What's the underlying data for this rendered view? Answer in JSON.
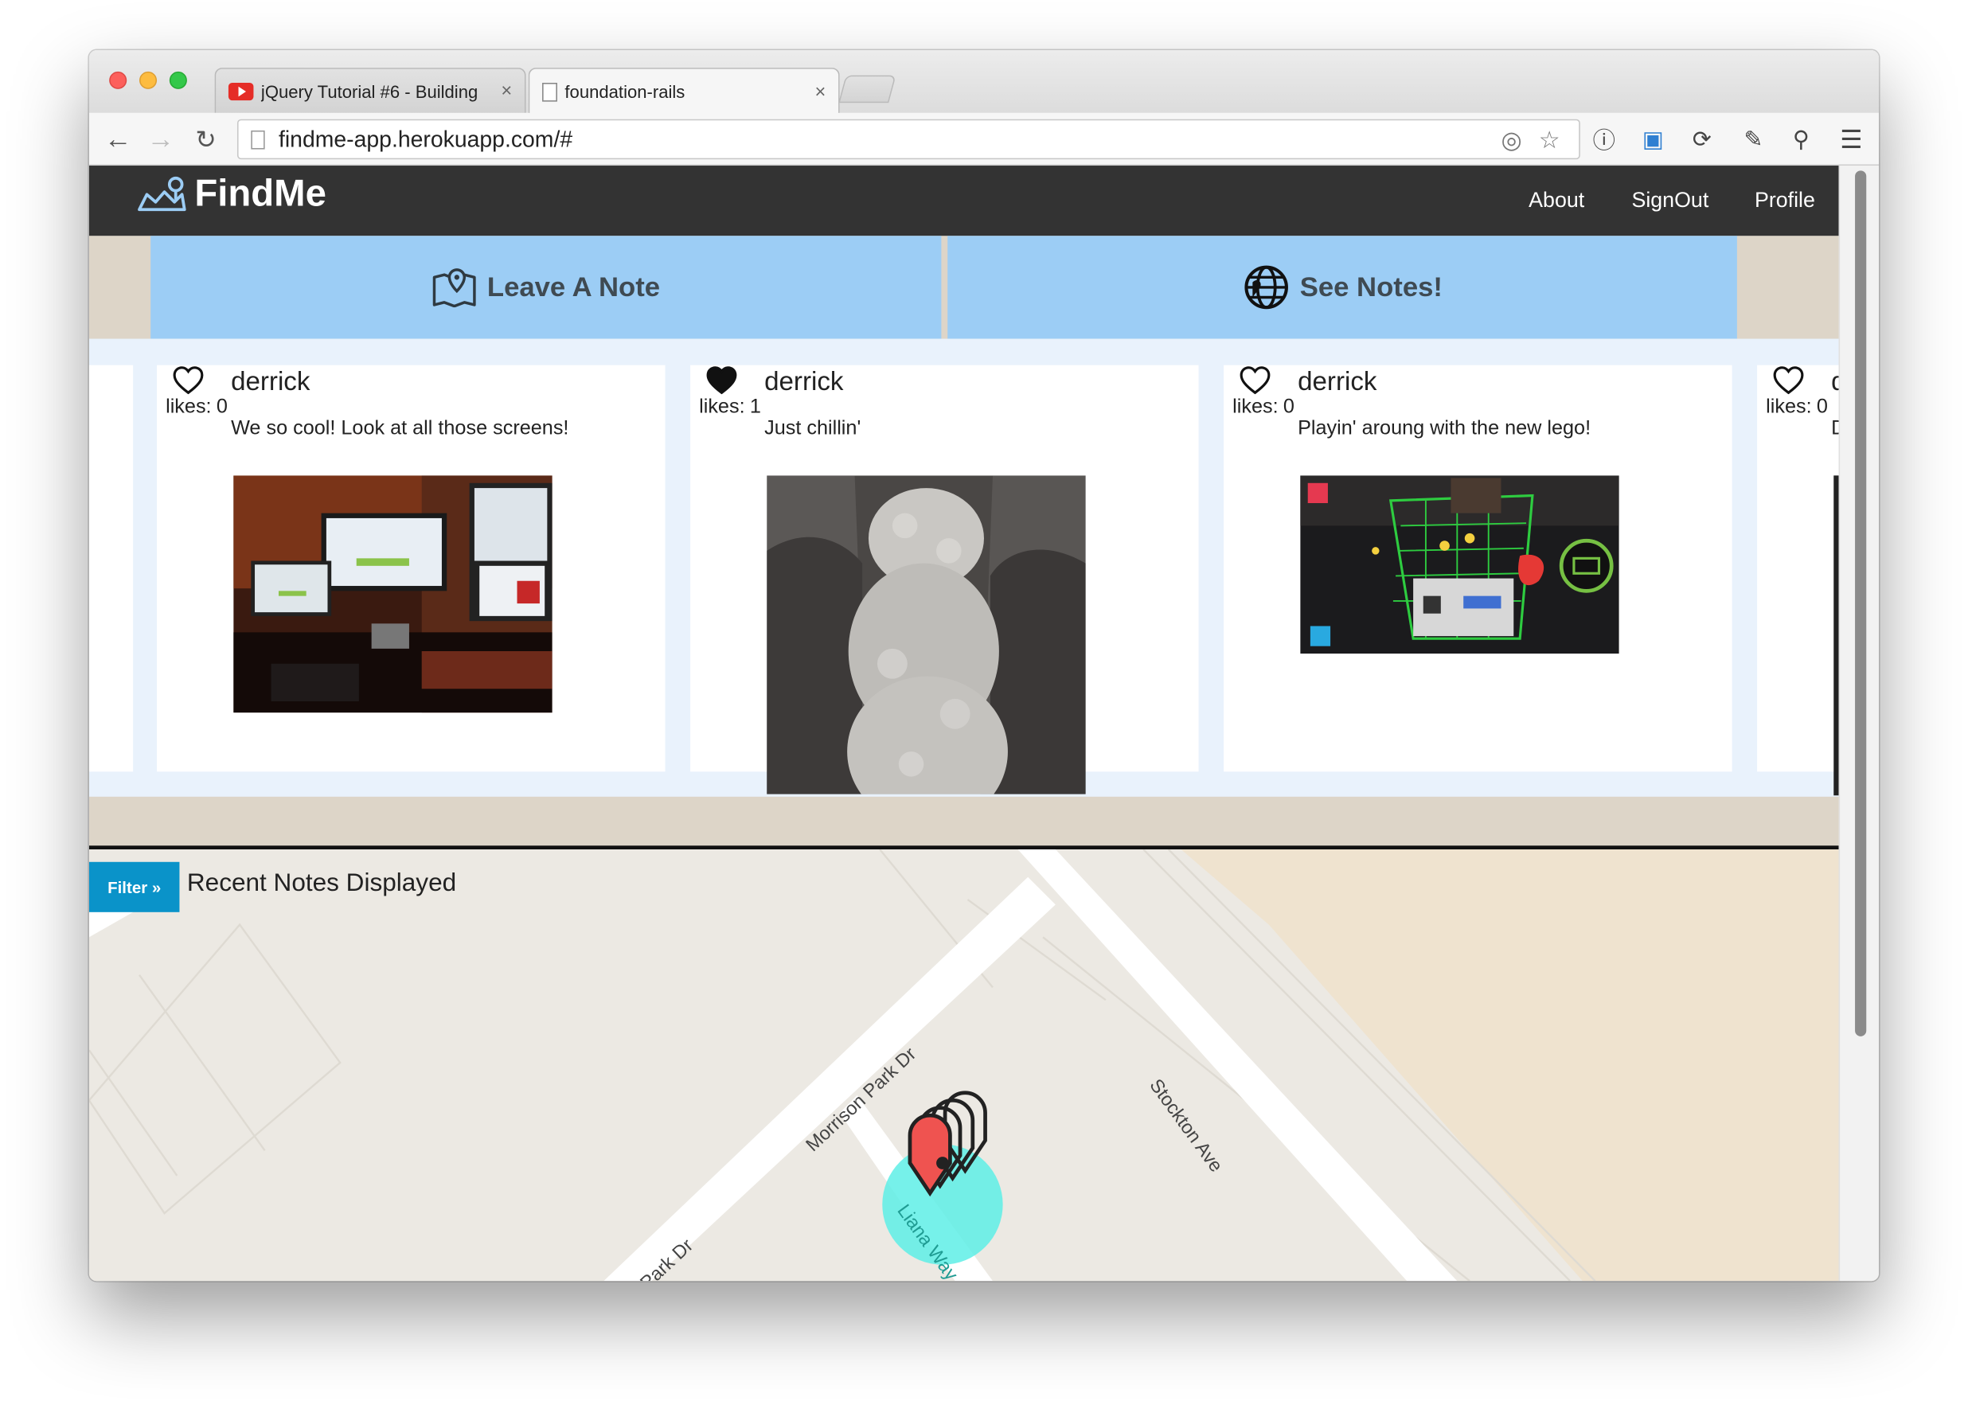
{
  "browser": {
    "tabs": [
      {
        "title": "jQuery Tutorial #6 - Building",
        "close": "×"
      },
      {
        "title": "foundation-rails",
        "close": "×"
      }
    ],
    "url": "findme-app.herokuapp.com/#"
  },
  "app": {
    "brand": "FindMe",
    "nav": {
      "about": "About",
      "signout": "SignOut",
      "profile": "Profile"
    },
    "actions": {
      "leave_note": "Leave A Note",
      "see_notes": "See Notes!"
    },
    "likes_label": "likes:",
    "notes": [
      {
        "user": "derrick",
        "likes": "0",
        "liked": false,
        "message": "We so cool! Look at all those screens!"
      },
      {
        "user": "derrick",
        "likes": "1",
        "liked": true,
        "message": "Just chillin'"
      },
      {
        "user": "derrick",
        "likes": "0",
        "liked": false,
        "message": "Playin' aroung with the new lego!"
      },
      {
        "user": "d",
        "likes": "0",
        "liked": false,
        "message": "D"
      }
    ],
    "map": {
      "filter_label": "Filter »",
      "title": "Recent Notes Displayed",
      "streets": [
        "Stockton Ave",
        "Morrison Park Dr",
        "Park Dr",
        "Liana Way"
      ]
    }
  },
  "colors": {
    "navbar": "#333333",
    "action": "#9ccdf5",
    "filter": "#0a93c9",
    "map_marker": "#ef5350",
    "map_circle": "#5eeee6"
  }
}
